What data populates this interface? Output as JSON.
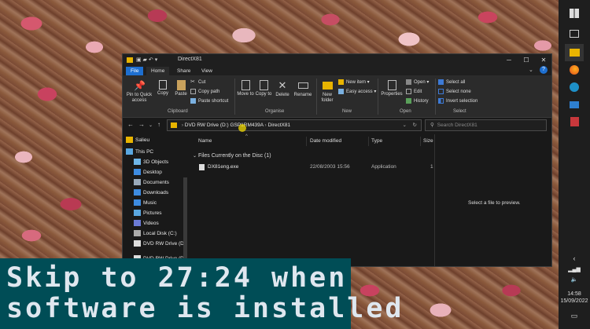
{
  "window": {
    "title": "DirectX81",
    "tabs": {
      "file": "File",
      "home": "Home",
      "share": "Share",
      "view": "View"
    }
  },
  "ribbon": {
    "pin": "Pin to Quick access",
    "copy": "Copy",
    "paste": "Paste",
    "cut": "Cut",
    "copy_path": "Copy path",
    "paste_shortcut": "Paste shortcut",
    "clipboard_group": "Clipboard",
    "move_to": "Move to",
    "copy_to": "Copy to",
    "delete": "Delete",
    "rename": "Rename",
    "organise_group": "Organise",
    "new_folder": "New folder",
    "new_item": "New item",
    "easy_access": "Easy access",
    "new_group": "New",
    "properties": "Properties",
    "open": "Open",
    "edit": "Edit",
    "history": "History",
    "open_group": "Open",
    "select_all": "Select all",
    "select_none": "Select none",
    "invert_selection": "Invert selection",
    "select_group": "Select"
  },
  "address": {
    "segment1": "DVD RW Drive (D:) GSP1RM439A",
    "segment2": "DirectX81",
    "search_placeholder": "Search DirectX81"
  },
  "nav_pane": {
    "items": [
      "Salieu",
      "This PC",
      "3D Objects",
      "Desktop",
      "Documents",
      "Downloads",
      "Music",
      "Pictures",
      "Videos",
      "Local Disk (C:)",
      "DVD RW Drive (D",
      "DVD RW Drive (D"
    ]
  },
  "content": {
    "columns": {
      "name": "Name",
      "date": "Date modified",
      "type": "Type",
      "size": "Size"
    },
    "group_header": "Files Currently on the Disc (1)",
    "files": [
      {
        "name": "DX81eng.exe",
        "date": "22/08/2003 15:56",
        "type": "Application",
        "size": "1"
      }
    ]
  },
  "preview": {
    "message": "Select a file to preview."
  },
  "overlay": {
    "line1": "Skip to 27:24 when",
    "line2": "software is installed"
  },
  "taskbar": {
    "time": "14:58",
    "date": "15/09/2022"
  }
}
